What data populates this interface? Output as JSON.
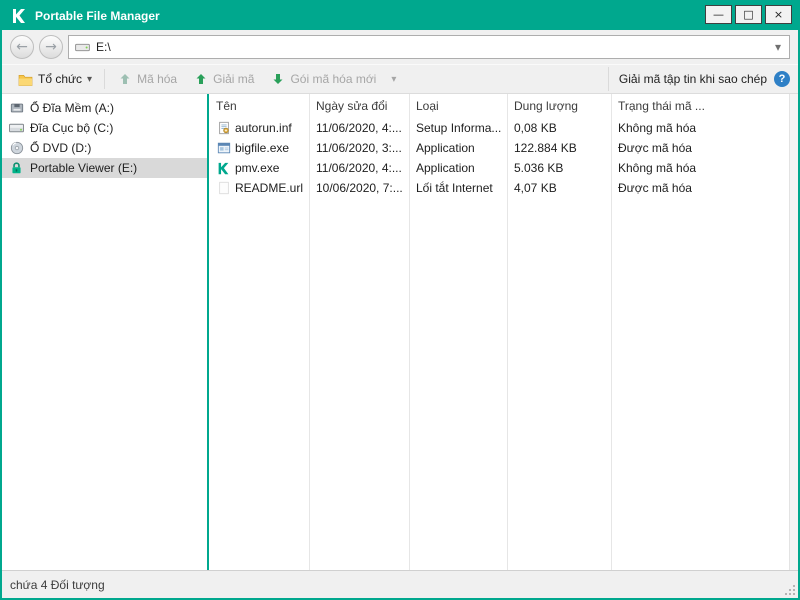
{
  "window": {
    "title": "Portable File Manager",
    "minimize_glyph": "—",
    "maximize_glyph": "□",
    "close_glyph": "×"
  },
  "nav": {
    "back_glyph": "←",
    "forward_glyph": "→",
    "address": "E:\\",
    "address_dropdown_glyph": "▾"
  },
  "toolbar": {
    "organize_label": "Tổ chức",
    "organize_caret": "▾",
    "encrypt_label": "Mã hóa",
    "decrypt_label": "Giải mã",
    "new_package_label": "Gói mã hóa mới",
    "new_package_caret": "▾",
    "decrypt_on_copy_label": "Giải mã tập tin khi sao chép",
    "help_glyph": "?"
  },
  "sidebar": {
    "items": [
      {
        "label": "Ổ Đĩa Mềm (A:)",
        "icon": "floppy-drive-icon"
      },
      {
        "label": "Đĩa Cục bộ (C:)",
        "icon": "hard-drive-icon"
      },
      {
        "label": "Ổ DVD (D:)",
        "icon": "dvd-drive-icon"
      },
      {
        "label": "Portable Viewer (E:)",
        "icon": "lock-icon",
        "selected": true
      }
    ]
  },
  "file_list": {
    "columns": [
      "Tên",
      "Ngày sửa đổi",
      "Loại",
      "Dung lượng",
      "Trạng thái mã ..."
    ],
    "rows": [
      {
        "name": "autorun.inf",
        "modified": "11/06/2020, 4:...",
        "type": "Setup Informa...",
        "size": "0,08 KB",
        "status": "Không mã hóa",
        "icon": "ini-file-icon"
      },
      {
        "name": "bigfile.exe",
        "modified": "11/06/2020, 3:...",
        "type": "Application",
        "size": "122.884 KB",
        "status": "Được mã hóa",
        "icon": "exe-file-icon"
      },
      {
        "name": "pmv.exe",
        "modified": "11/06/2020, 4:...",
        "type": "Application",
        "size": "5.036 KB",
        "status": "Không mã hóa",
        "icon": "kaspersky-file-icon"
      },
      {
        "name": "README.url",
        "modified": "10/06/2020, 7:...",
        "type": "Lối tắt Internet",
        "size": "4,07 KB",
        "status": "Được mã hóa",
        "icon": "url-file-icon"
      }
    ]
  },
  "status_bar": {
    "text": "chứa 4 Đối tượng"
  },
  "colors": {
    "titlebar_green": "#00a88e",
    "help_blue": "#2f80c6",
    "selection_gray": "#d9d9d9"
  }
}
